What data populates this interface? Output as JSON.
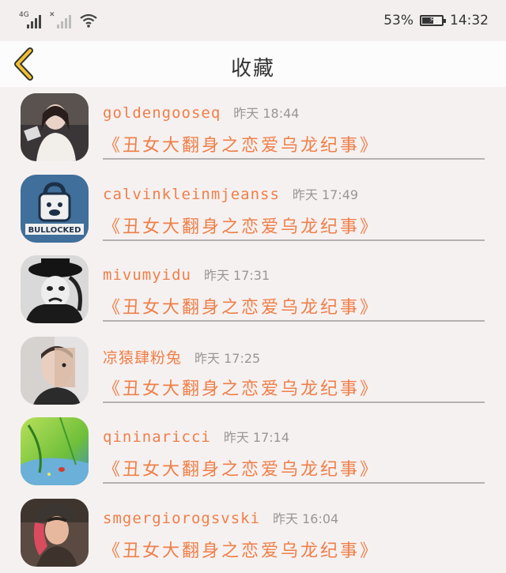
{
  "status_bar": {
    "network_label": "4G",
    "battery_percent": "53%",
    "battery_level": 0.53,
    "time": "14:32"
  },
  "header": {
    "title": "收藏",
    "back_icon": "chevron-left-icon",
    "accent_color": "#f2c22e"
  },
  "favorites": [
    {
      "username": "goldengooseq",
      "time": "昨天 18:44",
      "novel": "《丑女大翻身之恋爱乌龙纪事》"
    },
    {
      "username": "calvinkleinmjeanss",
      "time": "昨天 17:49",
      "novel": "《丑女大翻身之恋爱乌龙纪事》",
      "avatar_text": "BULLOCKED"
    },
    {
      "username": "mivumyidu",
      "time": "昨天 17:31",
      "novel": "《丑女大翻身之恋爱乌龙纪事》"
    },
    {
      "username": "凉猿肆粉兔",
      "time": "昨天 17:25",
      "novel": "《丑女大翻身之恋爱乌龙纪事》"
    },
    {
      "username": "qininaricci",
      "time": "昨天 17:14",
      "novel": "《丑女大翻身之恋爱乌龙纪事》"
    },
    {
      "username": "smgergiorogsvski",
      "time": "昨天 16:04",
      "novel": "《丑女大翻身之恋爱乌龙纪事》"
    }
  ],
  "colors": {
    "text_accent": "#ef7f48",
    "time_gray": "#9a9696",
    "background": "#f6f1f1"
  }
}
